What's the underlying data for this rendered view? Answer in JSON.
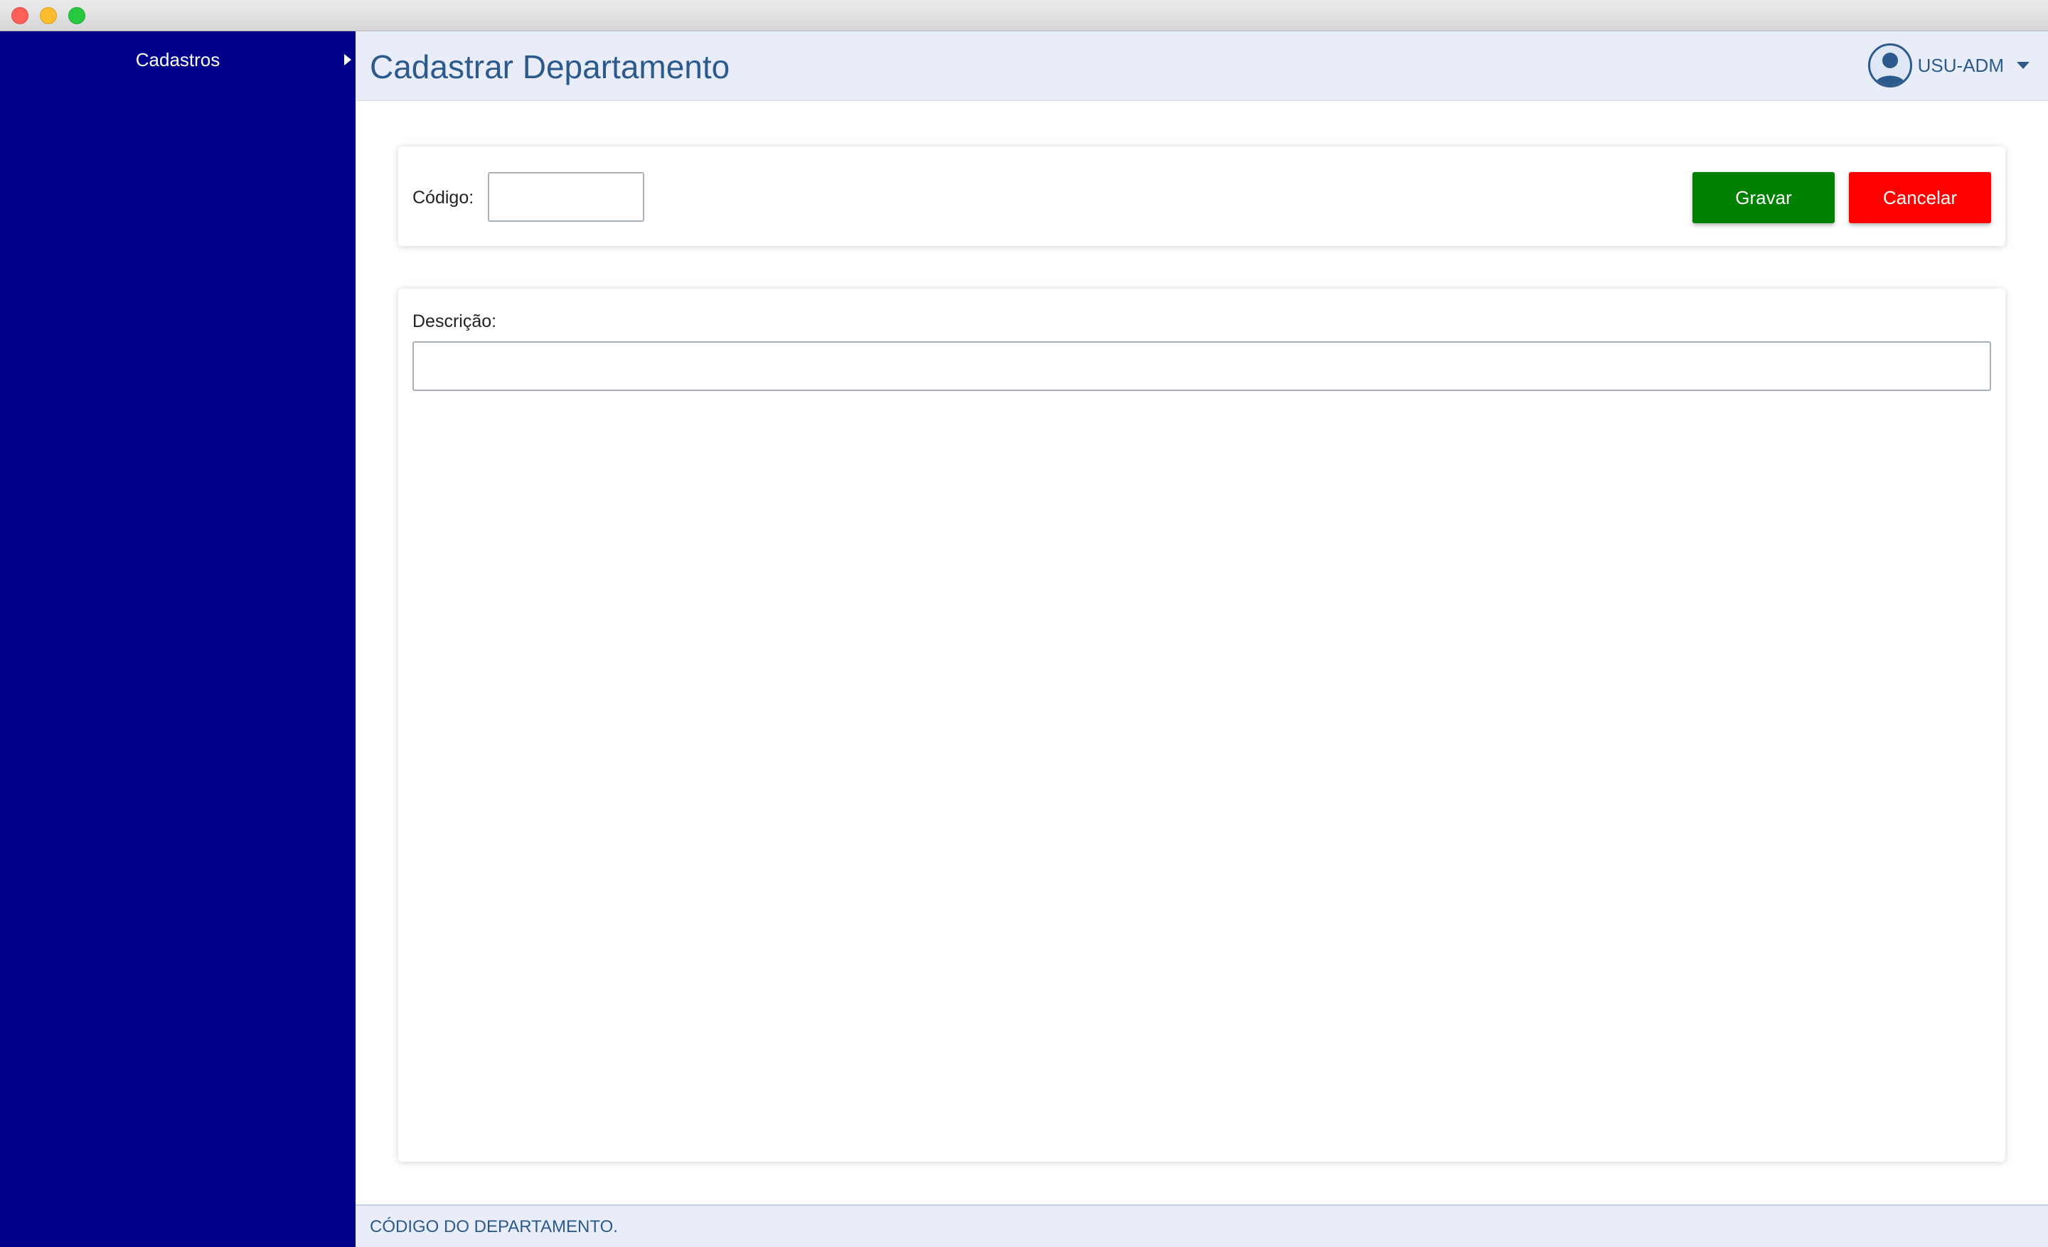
{
  "sidebar": {
    "items": [
      {
        "label": "Cadastros",
        "has_submenu": true
      }
    ],
    "background_color": "#00008b"
  },
  "header": {
    "title": "Cadastrar Departamento",
    "user": {
      "name": "USU-ADM",
      "avatar_icon": "user-avatar-icon",
      "caret_icon": "caret-down-icon"
    }
  },
  "form": {
    "codigo": {
      "label": "Código:",
      "value": "",
      "placeholder": ""
    },
    "descricao": {
      "label": "Descrição:",
      "value": "",
      "placeholder": ""
    },
    "buttons": {
      "save_label": "Gravar",
      "cancel_label": "Cancelar"
    }
  },
  "statusbar": {
    "text": "CÓDIGO DO DEPARTAMENTO."
  },
  "colors": {
    "accent": "#2c5a8c",
    "save": "#008000",
    "cancel": "#ff0000"
  }
}
